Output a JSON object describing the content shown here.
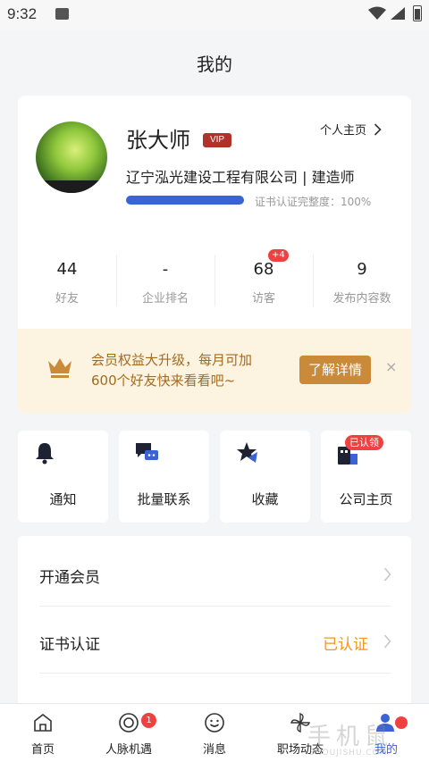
{
  "status_bar": {
    "time": "9:32"
  },
  "page_title": "我的",
  "profile": {
    "name": "张大师",
    "vip_label": "VIP",
    "homepage_label": "个人主页",
    "company": "辽宁泓光建设工程有限公司 | 建造师",
    "cert_progress": 100,
    "cert_label": "证书认证完整度：100%"
  },
  "stats": [
    {
      "value": "44",
      "label": "好友",
      "badge": ""
    },
    {
      "value": "-",
      "label": "企业排名",
      "badge": ""
    },
    {
      "value": "68",
      "label": "访客",
      "badge": "+4"
    },
    {
      "value": "9",
      "label": "发布内容数",
      "badge": ""
    }
  ],
  "promo": {
    "line1": "会员权益大升级，每月可加",
    "line2": "600个好友快来看看吧~",
    "button": "了解详情",
    "close": "×"
  },
  "quick_actions": [
    {
      "label": "通知",
      "badge": "",
      "icon": "bell-icon"
    },
    {
      "label": "批量联系",
      "badge": "",
      "icon": "chat-icon"
    },
    {
      "label": "收藏",
      "badge": "",
      "icon": "star-icon"
    },
    {
      "label": "公司主页",
      "badge": "已认领",
      "icon": "building-icon"
    }
  ],
  "menu": [
    {
      "label": "开通会员",
      "value": ""
    },
    {
      "label": "证书认证",
      "value": "已认证"
    }
  ],
  "tabs": [
    {
      "label": "首页",
      "badge": "",
      "active": false
    },
    {
      "label": "人脉机遇",
      "badge": "1",
      "active": false
    },
    {
      "label": "消息",
      "badge": "",
      "active": false
    },
    {
      "label": "职场动态",
      "badge": "",
      "active": false
    },
    {
      "label": "我的",
      "badge": "",
      "active": true
    }
  ],
  "watermark": {
    "big": "手机鼠",
    "small": "SHOUJISHU.COM"
  },
  "colors": {
    "accent": "#3a63d6",
    "promo_bg": "#fdf3e1",
    "promo_btn": "#c98a3a",
    "badge": "#f04141",
    "verified": "#f0961e"
  }
}
